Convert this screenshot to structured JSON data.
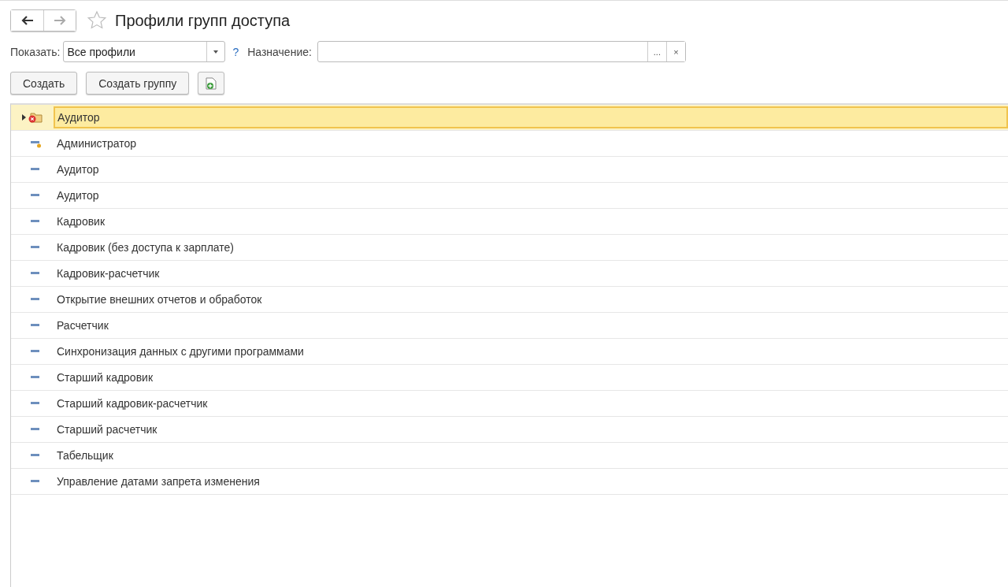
{
  "window": {
    "title": "Профили групп доступа",
    "favorite": false
  },
  "filters": {
    "show_label": "Показать:",
    "show_value": "Все профили",
    "help": "?",
    "purpose_label": "Назначение:",
    "select_button": "...",
    "clear_button": "×"
  },
  "buttons": [
    "Создать",
    "Создать группу"
  ],
  "rows": [
    {
      "kind": "group",
      "name": "Аудитор",
      "selected": true,
      "expanded": false,
      "deleted": true
    },
    {
      "kind": "predefined",
      "name": "Администратор",
      "selected": false
    },
    {
      "kind": "item",
      "name": "Аудитор",
      "selected": false
    },
    {
      "kind": "item",
      "name": "Аудитор",
      "selected": false
    },
    {
      "kind": "item",
      "name": "Кадровик",
      "selected": false
    },
    {
      "kind": "item",
      "name": "Кадровик (без доступа к зарплате)",
      "selected": false
    },
    {
      "kind": "item",
      "name": "Кадровик-расчетчик",
      "selected": false
    },
    {
      "kind": "item",
      "name": "Открытие внешних отчетов и обработок",
      "selected": false
    },
    {
      "kind": "item",
      "name": "Расчетчик",
      "selected": false
    },
    {
      "kind": "item",
      "name": "Синхронизация данных с другими программами",
      "selected": false
    },
    {
      "kind": "item",
      "name": "Старший кадровик",
      "selected": false
    },
    {
      "kind": "item",
      "name": "Старший кадровик-расчетчик",
      "selected": false
    },
    {
      "kind": "item",
      "name": "Старший расчетчик",
      "selected": false
    },
    {
      "kind": "item",
      "name": "Табельщик",
      "selected": false
    },
    {
      "kind": "item",
      "name": "Управление датами запрета изменения",
      "selected": false
    }
  ]
}
